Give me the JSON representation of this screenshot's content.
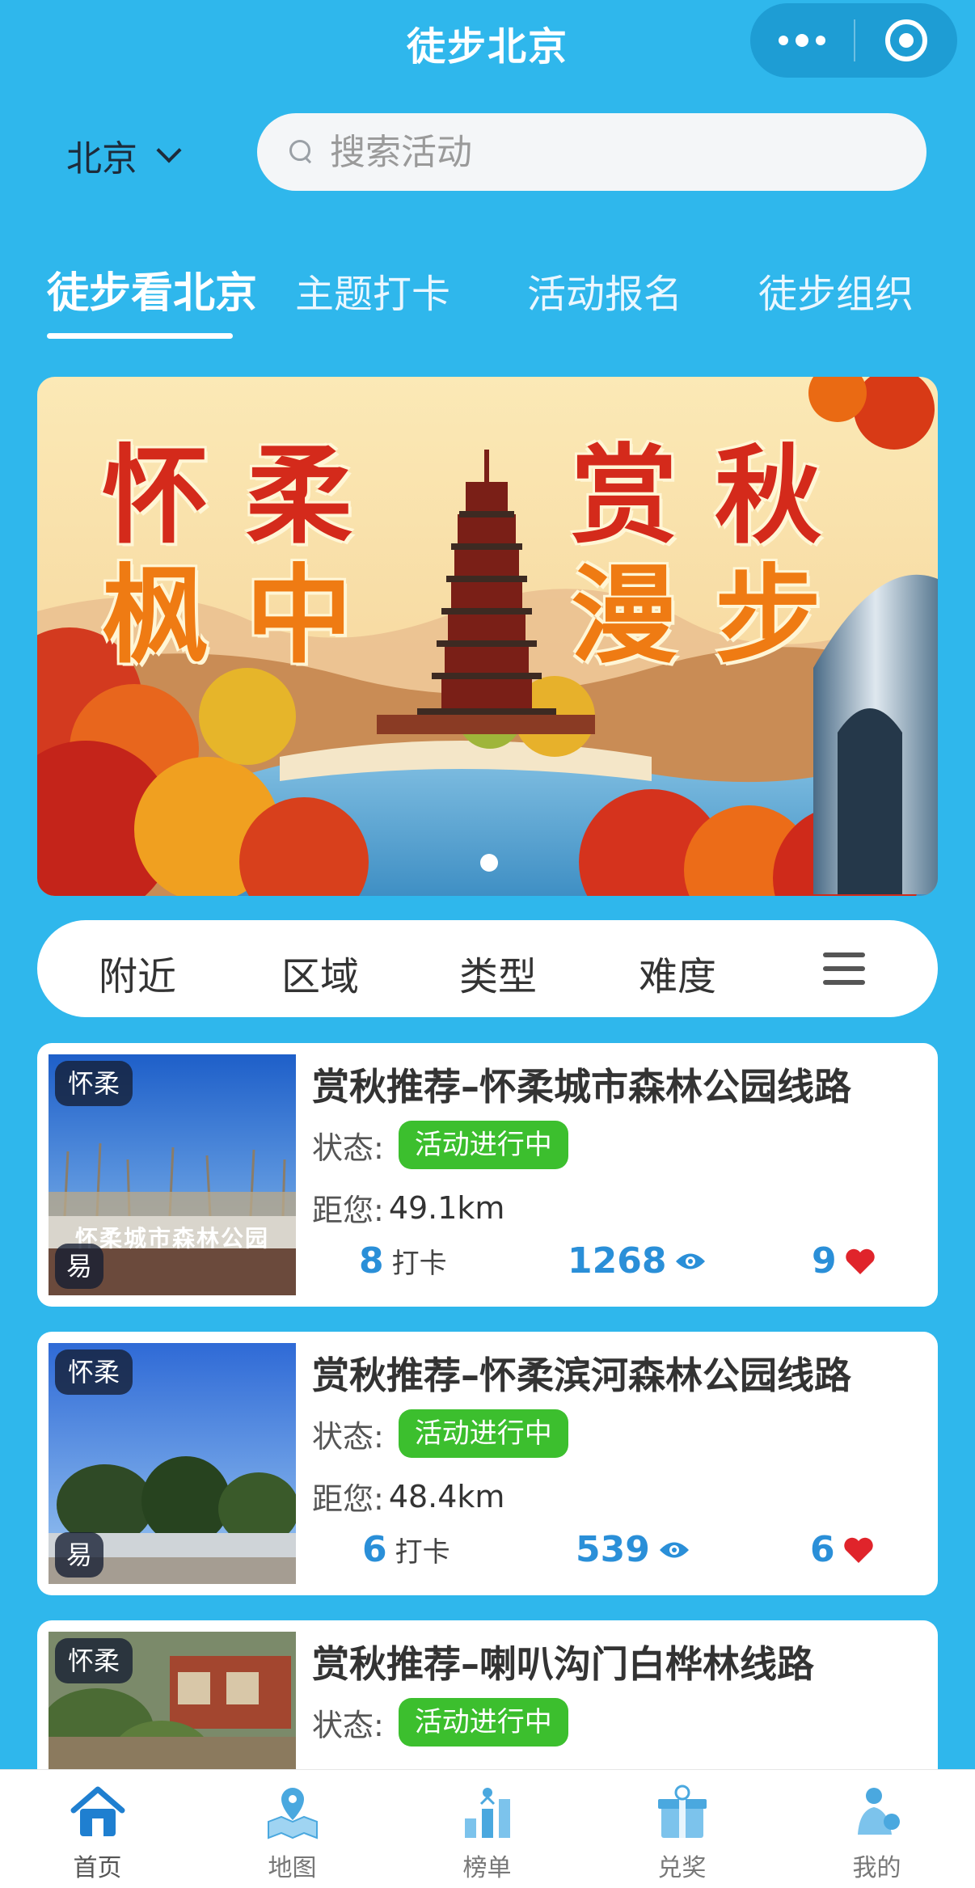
{
  "header": {
    "title": "徒步北京"
  },
  "city": {
    "name": "北京"
  },
  "search": {
    "placeholder": "搜索活动"
  },
  "tabs": [
    {
      "label": "徒步看北京",
      "active": true
    },
    {
      "label": "主题打卡",
      "active": false
    },
    {
      "label": "活动报名",
      "active": false
    },
    {
      "label": "徒步组织",
      "active": false
    }
  ],
  "banner": {
    "line1_left": "怀 柔",
    "line1_right": "赏 秋",
    "line2_left": "枫 中",
    "line2_right": "漫 步",
    "slide_index": 1
  },
  "filter": {
    "items": [
      "附近",
      "区域",
      "类型",
      "难度"
    ]
  },
  "activities": [
    {
      "area": "怀柔",
      "level": "易",
      "title": "赏秋推荐–怀柔城市森林公园线路",
      "status_label": "状态:",
      "status": "活动进行中",
      "distance_label": "距您:",
      "distance": "49.1km",
      "checkins": "8",
      "checkin_unit": "打卡",
      "views": "1268",
      "likes": "9",
      "sign_text": "怀柔城市森林公园"
    },
    {
      "area": "怀柔",
      "level": "易",
      "title": "赏秋推荐–怀柔滨河森林公园线路",
      "status_label": "状态:",
      "status": "活动进行中",
      "distance_label": "距您:",
      "distance": "48.4km",
      "checkins": "6",
      "checkin_unit": "打卡",
      "views": "539",
      "likes": "6"
    },
    {
      "area": "怀柔",
      "title": "赏秋推荐–喇叭沟门白桦林线路",
      "status_label": "状态:",
      "status": "活动进行中"
    }
  ],
  "bottom_nav": [
    {
      "label": "首页",
      "icon": "home-icon",
      "active": true
    },
    {
      "label": "地图",
      "icon": "map-icon",
      "active": false
    },
    {
      "label": "榜单",
      "icon": "ranking-icon",
      "active": false
    },
    {
      "label": "兑奖",
      "icon": "gift-icon",
      "active": false
    },
    {
      "label": "我的",
      "icon": "profile-icon",
      "active": false
    }
  ],
  "colors": {
    "background": "#2fb7ec",
    "accent_blue": "#2a8fd8",
    "status_green": "#3cbf2e",
    "like_red": "#e0242b",
    "nav_active": "#1f7fd0"
  }
}
